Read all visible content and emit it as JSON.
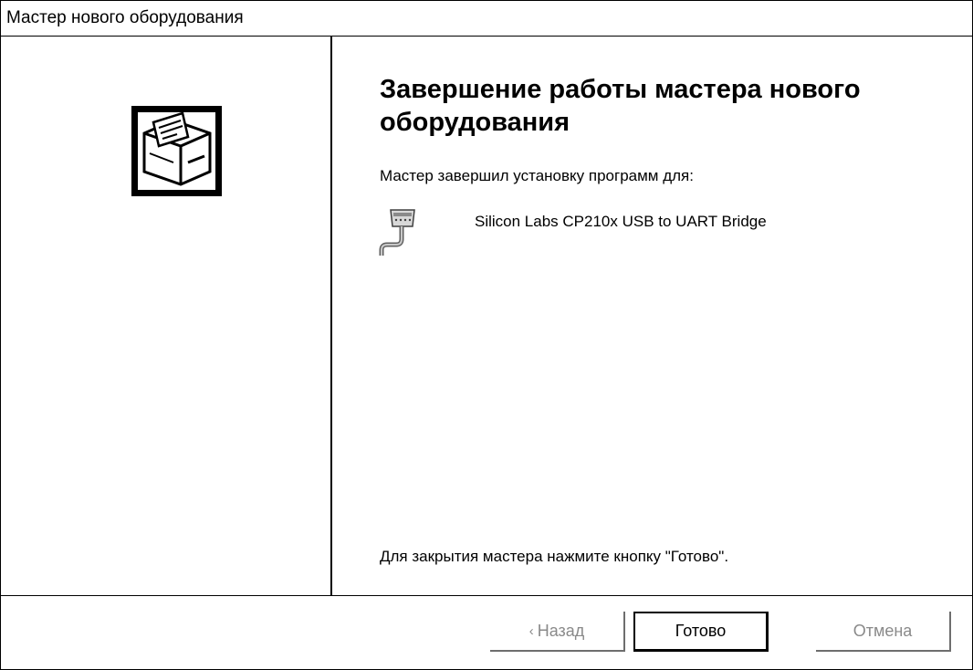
{
  "window": {
    "title": "Мастер нового оборудования"
  },
  "sidebar": {
    "logo_icon": "hardware-wizard-icon"
  },
  "content": {
    "heading": "Завершение работы мастера нового оборудования",
    "intro": "Мастер завершил установку программ для:",
    "device": {
      "icon": "serial-port-icon",
      "name": "Silicon Labs CP210x USB to UART Bridge"
    },
    "closing": "Для закрытия мастера нажмите кнопку \"Готово\"."
  },
  "buttons": {
    "back": {
      "chevron": "‹",
      "label": "Назад",
      "enabled": false
    },
    "finish": {
      "label": "Готово",
      "enabled": true
    },
    "cancel": {
      "label": "Отмена",
      "enabled": false
    }
  },
  "colors": {
    "background": "#ffffff",
    "text": "#000000",
    "disabled_text": "#8a8a8a"
  }
}
